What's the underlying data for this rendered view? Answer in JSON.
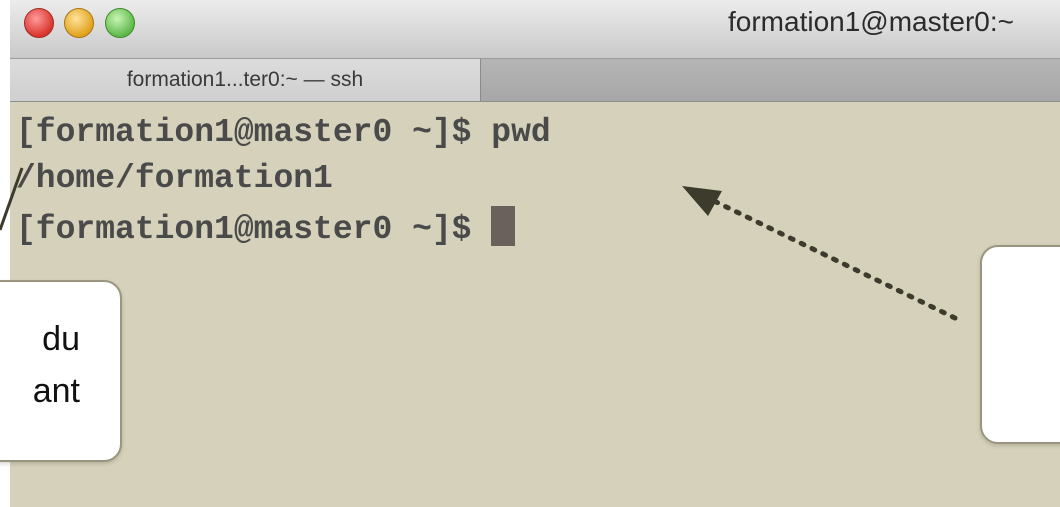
{
  "window": {
    "title": "formation1@master0:~",
    "tab_label": "formation1...ter0:~ — ssh"
  },
  "terminal": {
    "lines": [
      "[formation1@master0 ~]$ pwd",
      "/home/formation1",
      "[formation1@master0 ~]$ "
    ]
  },
  "callouts": {
    "left_line1": "du",
    "left_line2": "ant"
  },
  "colors": {
    "terminal_bg": "#d5d1ba",
    "cursor": "#6a605c"
  }
}
